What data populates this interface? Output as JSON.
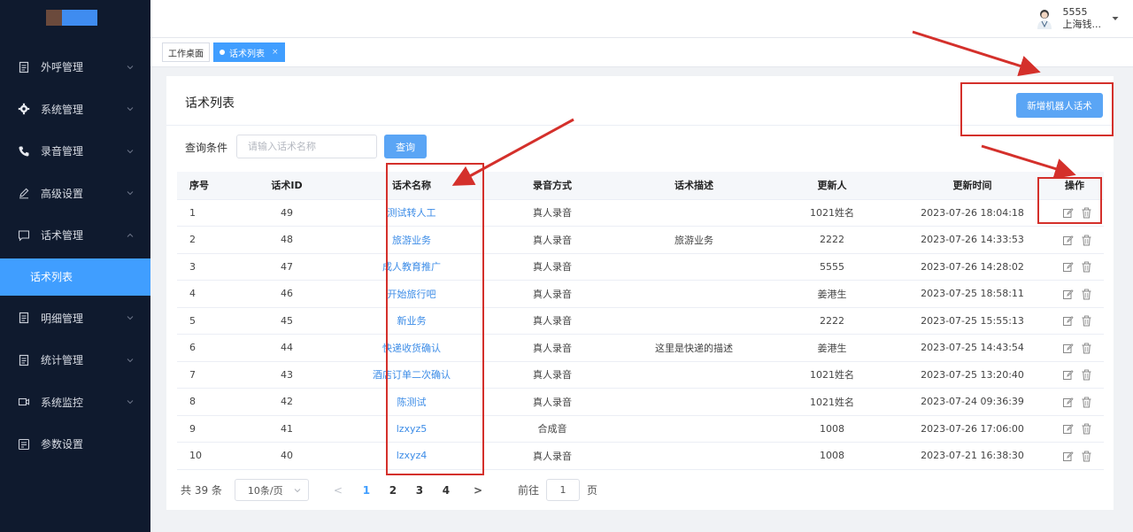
{
  "sidebar": {
    "items": [
      {
        "label": "外呼管理",
        "icon": "document-icon"
      },
      {
        "label": "系统管理",
        "icon": "gear-icon"
      },
      {
        "label": "录音管理",
        "icon": "phone-icon"
      },
      {
        "label": "高级设置",
        "icon": "pen-icon"
      },
      {
        "label": "话术管理",
        "icon": "chat-icon"
      },
      {
        "label": "话术列表",
        "icon": ""
      },
      {
        "label": "明细管理",
        "icon": "document-icon"
      },
      {
        "label": "统计管理",
        "icon": "document-icon"
      },
      {
        "label": "系统监控",
        "icon": "camera-icon"
      },
      {
        "label": "参数设置",
        "icon": "settings-doc-icon"
      }
    ]
  },
  "header": {
    "user_name": "5555",
    "user_org": "上海钱..."
  },
  "tabs": [
    {
      "label": "工作桌面"
    },
    {
      "label": "话术列表",
      "close": "×"
    }
  ],
  "main": {
    "title": "话术列表",
    "add_button": "新增机器人话术",
    "query_label": "查询条件",
    "query_placeholder": "请输入话术名称",
    "query_button": "查询"
  },
  "table": {
    "columns": [
      "序号",
      "话术ID",
      "话术名称",
      "录音方式",
      "话术描述",
      "更新人",
      "更新时间",
      "操作"
    ],
    "rows": [
      {
        "idx": "1",
        "id": "49",
        "name": "测试转人工",
        "mode": "真人录音",
        "desc": "",
        "user": "1021姓名",
        "time": "2023-07-26 18:04:18"
      },
      {
        "idx": "2",
        "id": "48",
        "name": "旅游业务",
        "mode": "真人录音",
        "desc": "旅游业务",
        "user": "2222",
        "time": "2023-07-26 14:33:53"
      },
      {
        "idx": "3",
        "id": "47",
        "name": "成人教育推广",
        "mode": "真人录音",
        "desc": "",
        "user": "5555",
        "time": "2023-07-26 14:28:02"
      },
      {
        "idx": "4",
        "id": "46",
        "name": "开始旅行吧",
        "mode": "真人录音",
        "desc": "",
        "user": "姜港生",
        "time": "2023-07-25 18:58:11"
      },
      {
        "idx": "5",
        "id": "45",
        "name": "新业务",
        "mode": "真人录音",
        "desc": "",
        "user": "2222",
        "time": "2023-07-25 15:55:13"
      },
      {
        "idx": "6",
        "id": "44",
        "name": "快递收货确认",
        "mode": "真人录音",
        "desc": "这里是快递的描述",
        "user": "姜港生",
        "time": "2023-07-25 14:43:54"
      },
      {
        "idx": "7",
        "id": "43",
        "name": "酒店订单二次确认",
        "mode": "真人录音",
        "desc": "",
        "user": "1021姓名",
        "time": "2023-07-25 13:20:40"
      },
      {
        "idx": "8",
        "id": "42",
        "name": "陈测试",
        "mode": "真人录音",
        "desc": "",
        "user": "1021姓名",
        "time": "2023-07-24 09:36:39"
      },
      {
        "idx": "9",
        "id": "41",
        "name": "lzxyz5",
        "mode": "合成音",
        "desc": "",
        "user": "1008",
        "time": "2023-07-26 17:06:00"
      },
      {
        "idx": "10",
        "id": "40",
        "name": "lzxyz4",
        "mode": "真人录音",
        "desc": "",
        "user": "1008",
        "time": "2023-07-21 16:38:30"
      }
    ]
  },
  "pager": {
    "total": "共 39 条",
    "page_size": "10条/页",
    "prev": "<",
    "pages": [
      "1",
      "2",
      "3",
      "4"
    ],
    "current": "1",
    "next": ">",
    "goto_label": "前往",
    "goto_value": "1",
    "goto_unit": "页"
  },
  "colors": {
    "sidebar_bg": "#0f1a2e",
    "accent": "#409eff",
    "link": "#3c8ce7",
    "annotation": "#d4302b"
  }
}
